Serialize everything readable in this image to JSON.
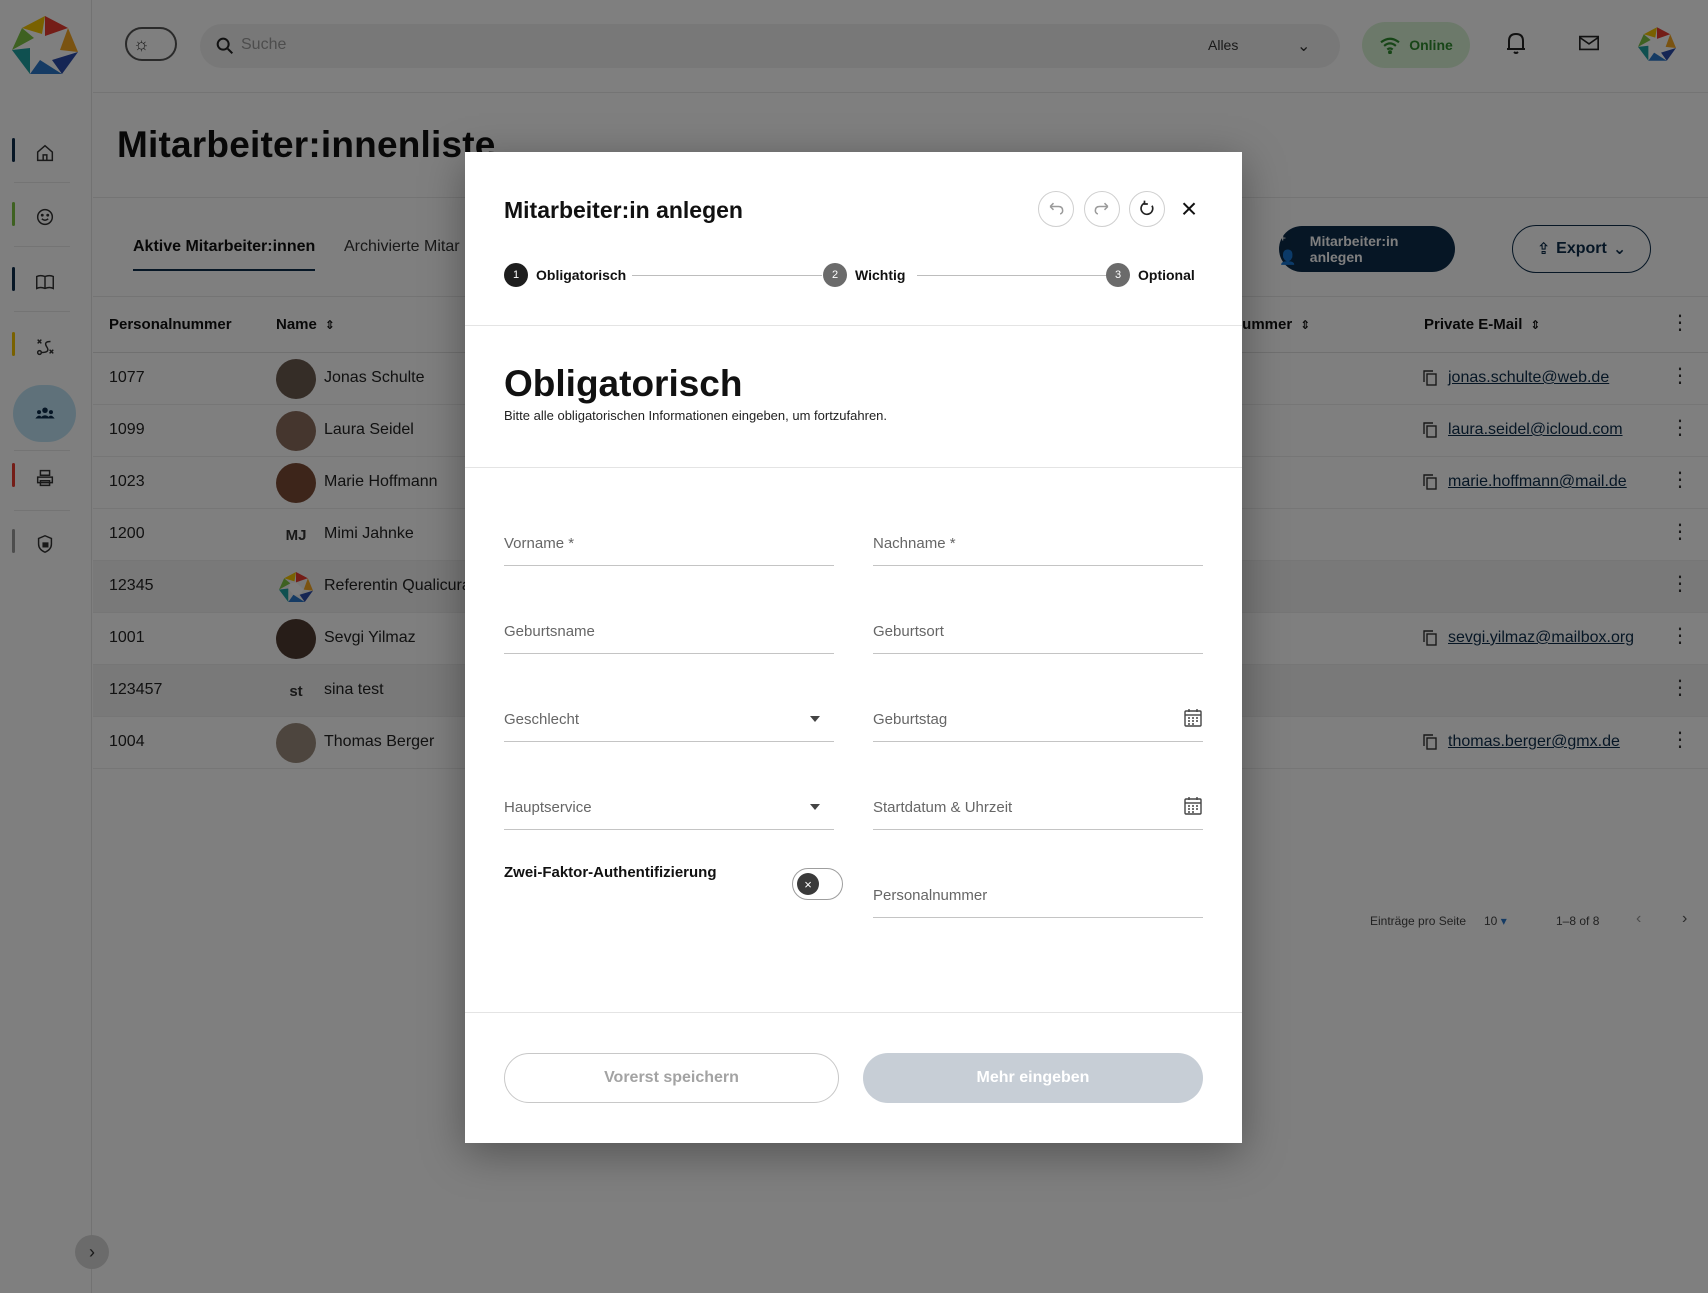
{
  "topbar": {
    "search_placeholder": "Suche",
    "search_scope": "Alles",
    "status": "Online",
    "status_color": "#2e8b2e"
  },
  "page": {
    "title": "Mitarbeiter:innenliste",
    "tabs": [
      {
        "label": "Aktive Mitarbeiter:innen",
        "active": true
      },
      {
        "label": "Archivierte Mitar",
        "active": false
      }
    ],
    "add_button": "Mitarbeiter:in anlegen",
    "export_button": "Export"
  },
  "table": {
    "headers": {
      "personalnummer": "Personalnummer",
      "name": "Name",
      "hidden_col": "nummer",
      "private_email": "Private E-Mail"
    },
    "rows": [
      {
        "pn": "1077",
        "initials": "",
        "name": "Jonas Schulte",
        "email": "jonas.schulte@web.de"
      },
      {
        "pn": "1099",
        "initials": "",
        "name": "Laura Seidel",
        "email": "laura.seidel@icloud.com"
      },
      {
        "pn": "1023",
        "initials": "",
        "name": "Marie Hoffmann",
        "email": "marie.hoffmann@mail.de"
      },
      {
        "pn": "1200",
        "initials": "MJ",
        "name": "Mimi Jahnke",
        "email": ""
      },
      {
        "pn": "12345",
        "initials": "",
        "name": "Referentin Qualicura",
        "email": ""
      },
      {
        "pn": "1001",
        "initials": "",
        "name": "Sevgi Yilmaz",
        "email": "sevgi.yilmaz@mailbox.org"
      },
      {
        "pn": "123457",
        "initials": "st",
        "name": "sina test",
        "email": ""
      },
      {
        "pn": "1004",
        "initials": "",
        "name": "Thomas Berger",
        "email": "thomas.berger@gmx.de"
      }
    ],
    "pagination": {
      "per_page_label": "Einträge pro Seite",
      "per_page_value": "10",
      "range": "1–8 of 8"
    }
  },
  "modal": {
    "title": "Mitarbeiter:in anlegen",
    "steps": [
      {
        "num": "1",
        "label": "Obligatorisch",
        "active": true
      },
      {
        "num": "2",
        "label": "Wichtig",
        "active": false
      },
      {
        "num": "3",
        "label": "Optional",
        "active": false
      }
    ],
    "section_title": "Obligatorisch",
    "section_subtitle": "Bitte alle obligatorischen Informationen eingeben, um fortzufahren.",
    "fields": {
      "vorname": "Vorname *",
      "nachname": "Nachname *",
      "geburtsname": "Geburtsname",
      "geburtsort": "Geburtsort",
      "geschlecht": "Geschlecht",
      "geburtstag": "Geburtstag",
      "hauptservice": "Hauptservice",
      "startdatum": "Startdatum & Uhrzeit",
      "personalnummer": "Personalnummer"
    },
    "two_factor_label": "Zwei-Faktor-Authentifizierung",
    "two_factor_enabled": false,
    "save_button": "Vorerst speichern",
    "more_button": "Mehr eingeben"
  },
  "colors": {
    "primary": "#0d2d4a",
    "active_nav": "#bfe3f5",
    "disabled_button": "#c7ced6"
  }
}
